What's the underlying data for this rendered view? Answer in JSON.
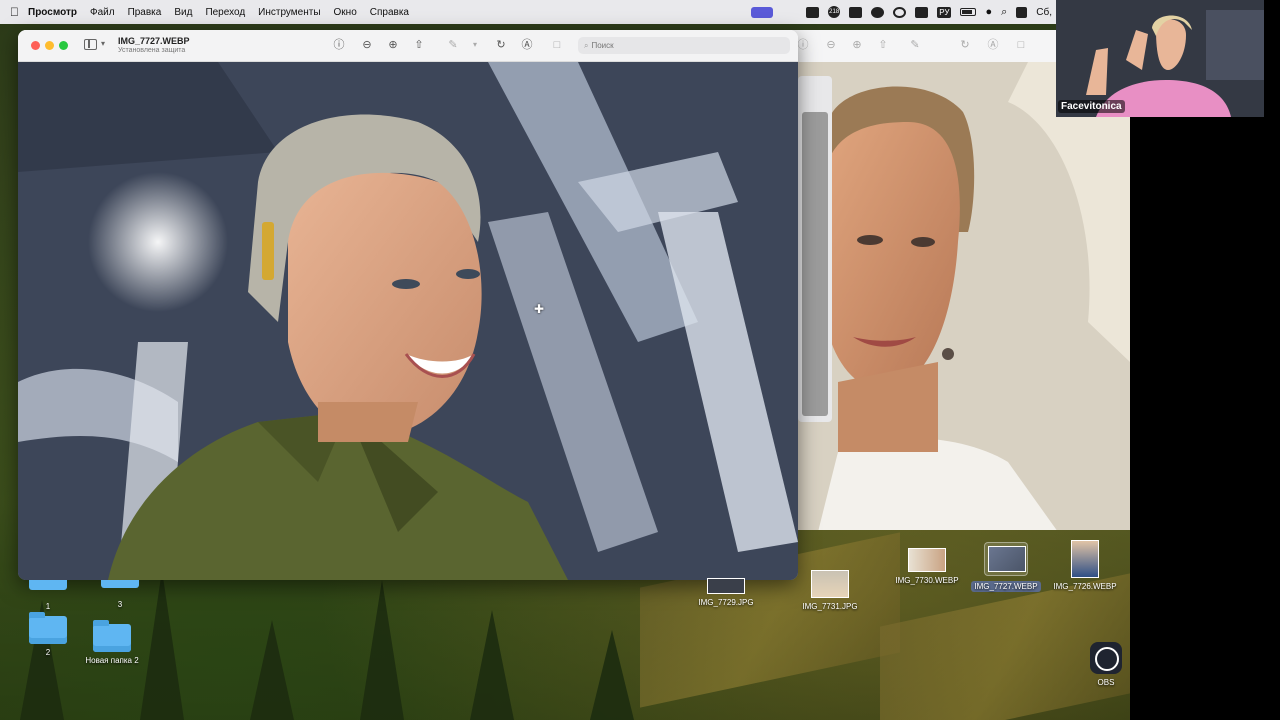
{
  "menubar": {
    "app_name": "Просмотр",
    "items": [
      "Файл",
      "Правка",
      "Вид",
      "Переход",
      "Инструменты",
      "Окно",
      "Справка"
    ],
    "status": {
      "language": "РУ",
      "clock": "Сб,",
      "notification_count": "218"
    }
  },
  "front_window": {
    "title": "IMG_7727.WEBP",
    "subtitle": "Установлена защита",
    "search_placeholder": "Поиск"
  },
  "desktop": {
    "folders": [
      {
        "label": "1"
      },
      {
        "label": "3"
      },
      {
        "label": "2"
      },
      {
        "label": "Новая папка 2"
      }
    ],
    "files": [
      {
        "label": "IMG_7729.JPG"
      },
      {
        "label": "IMG_7731.JPG"
      },
      {
        "label": "IMG_7730.WEBP"
      },
      {
        "label": "IMG_7727.WEBP"
      },
      {
        "label": "IMG_7726.WEBP"
      }
    ],
    "apps": [
      {
        "label": "OBS"
      }
    ]
  },
  "webcam": {
    "name": "Facevitonica"
  },
  "colors": {
    "accent": "#5a5ad8",
    "jacket_olive": "#55602a",
    "selection": "#5a6a8c"
  }
}
